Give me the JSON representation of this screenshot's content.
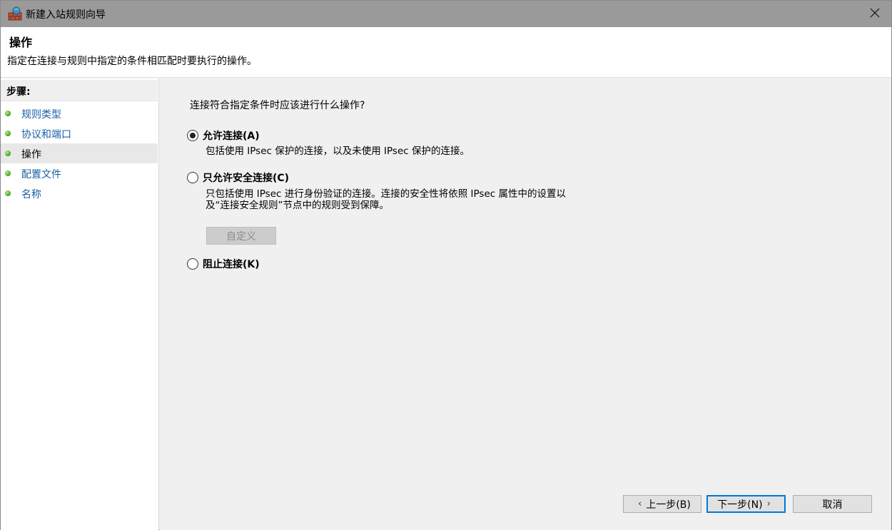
{
  "window": {
    "title": "新建入站规则向导",
    "close_icon": "close-icon"
  },
  "header": {
    "title": "操作",
    "description": "指定在连接与规则中指定的条件相匹配时要执行的操作。"
  },
  "sidebar": {
    "heading": "步骤:",
    "items": [
      {
        "label": "规则类型",
        "current": false
      },
      {
        "label": "协议和端口",
        "current": false
      },
      {
        "label": "操作",
        "current": true
      },
      {
        "label": "配置文件",
        "current": false
      },
      {
        "label": "名称",
        "current": false
      }
    ]
  },
  "main": {
    "question": "连接符合指定条件时应该进行什么操作?",
    "options": [
      {
        "label": "允许连接(A)",
        "checked": true,
        "description": "包括使用 IPsec 保护的连接，以及未使用 IPsec 保护的连接。"
      },
      {
        "label": "只允许安全连接(C)",
        "checked": false,
        "description_line1": "只包括使用 IPsec 进行身份验证的连接。连接的安全性将依照 IPsec 属性中的设置以",
        "description_line2": "及“连接安全规则”节点中的规则受到保障。",
        "customize_label": "自定义"
      },
      {
        "label": "阻止连接(K)",
        "checked": false
      }
    ]
  },
  "footer": {
    "back_label": "上一步(B)",
    "next_label": "下一步(N)",
    "cancel_label": "取消"
  },
  "colors": {
    "titlebar": "#9a9a9a",
    "link": "#1a5fa6",
    "primary_border": "#0078d7",
    "step_dot": "#3f9d22"
  }
}
